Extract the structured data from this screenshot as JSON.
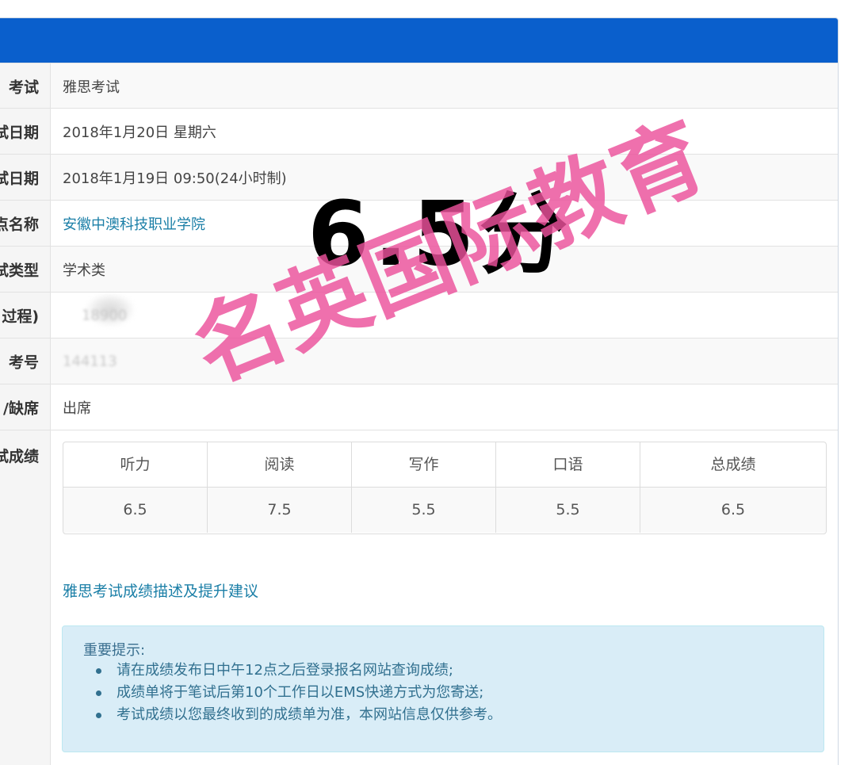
{
  "rows": [
    {
      "label": "考试",
      "value": "雅思考试"
    },
    {
      "label": "试日期",
      "value": "2018年1月20日 星期六"
    },
    {
      "label": "试日期",
      "value": "2018年1月19日 09:50(24小时制)"
    },
    {
      "label": "点名称",
      "value": "安徽中澳科技职业学院"
    },
    {
      "label": "试类型",
      "value": "学术类"
    },
    {
      "label": "过程)",
      "value": "18900"
    },
    {
      "label": "考号",
      "value": "144113"
    },
    {
      "label": "/缺席",
      "value": "出席"
    }
  ],
  "scores": {
    "label": "试成绩",
    "headers": [
      "听力",
      "阅读",
      "写作",
      "口语",
      "总成绩"
    ],
    "values": [
      "6.5",
      "7.5",
      "5.5",
      "5.5",
      "6.5"
    ]
  },
  "description_link": "雅思考试成绩描述及提升建议",
  "notice": {
    "title": "重要提示:",
    "items": [
      "请在成绩发布日中午12点之后登录报名网站查询成绩;",
      "成绩单将于笔试后第10个工作日以EMS快递方式为您寄送;",
      "考试成绩以您最终收到的成绩单为准，本网站信息仅供参考。"
    ]
  },
  "overlay_score": "6.5分",
  "watermark": "名英国际教育",
  "colors": {
    "header": "#0a5fcc",
    "link": "#1b7fa7",
    "notice_bg": "#d9edf7",
    "watermark": "#eb509b"
  }
}
